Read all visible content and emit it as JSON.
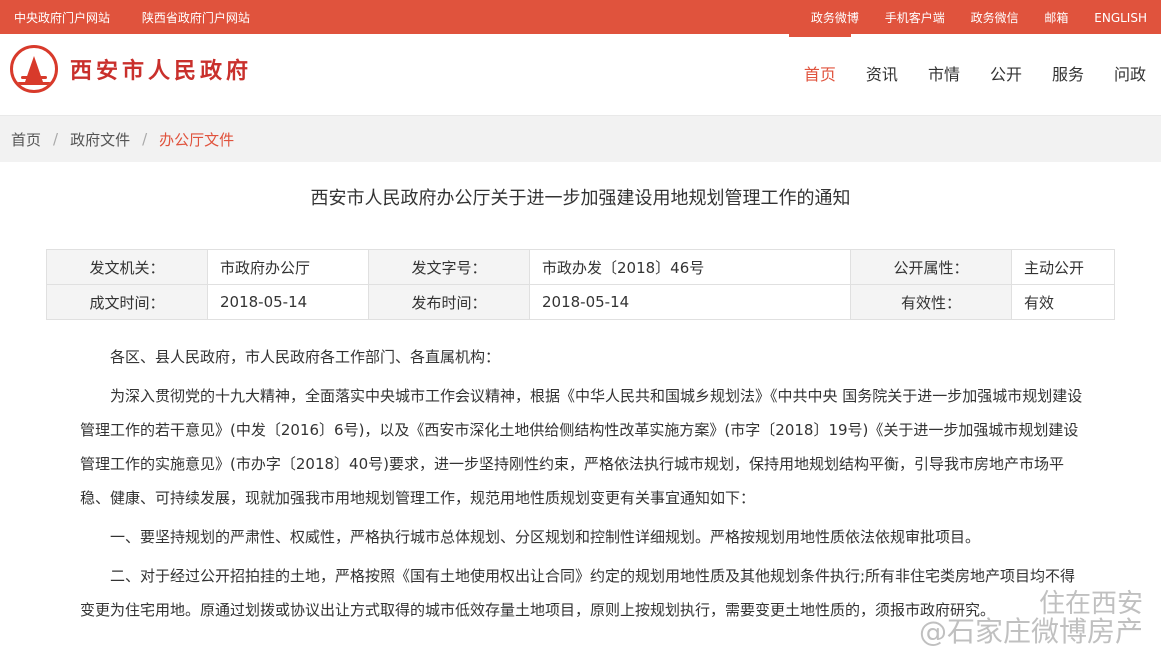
{
  "topbar": {
    "left": [
      "中央政府门户网站",
      "陕西省政府门户网站"
    ],
    "right": [
      "政务微博",
      "手机客户端",
      "政务微信",
      "邮箱",
      "ENGLISH"
    ]
  },
  "header": {
    "site_title": "西安市人民政府",
    "nav": [
      "首页",
      "资讯",
      "市情",
      "公开",
      "服务",
      "问政"
    ]
  },
  "breadcrumb": [
    "首页",
    "政府文件",
    "办公厅文件"
  ],
  "document": {
    "title": "西安市人民政府办公厅关于进一步加强建设用地规划管理工作的通知",
    "meta": {
      "issuer_label": "发文机关：",
      "issuer": "市政府办公厅",
      "docno_label": "发文字号：",
      "docno": "市政办发〔2018〕46号",
      "public_label": "公开属性：",
      "public": "主动公开",
      "created_label": "成文时间：",
      "created": "2018-05-14",
      "published_label": "发布时间：",
      "published": "2018-05-14",
      "validity_label": "有效性：",
      "validity": "有效"
    },
    "paragraphs": [
      "各区、县人民政府，市人民政府各工作部门、各直属机构：",
      "为深入贯彻党的十九大精神，全面落实中央城市工作会议精神，根据《中华人民共和国城乡规划法》《中共中央 国务院关于进一步加强城市规划建设管理工作的若干意见》(中发〔2016〕6号)，以及《西安市深化土地供给侧结构性改革实施方案》(市字〔2018〕19号)《关于进一步加强城市规划建设管理工作的实施意见》(市办字〔2018〕40号)要求，进一步坚持刚性约束，严格依法执行城市规划，保持用地规划结构平衡，引导我市房地产市场平稳、健康、可持续发展，现就加强我市用地规划管理工作，规范用地性质规划变更有关事宜通知如下：",
      "一、要坚持规划的严肃性、权威性，严格执行城市总体规划、分区规划和控制性详细规划。严格按规划用地性质依法依规审批项目。",
      "二、对于经过公开招拍挂的土地，严格按照《国有土地使用权出让合同》约定的规划用地性质及其他规划条件执行;所有非住宅类房地产项目均不得变更为住宅用地。原通过划拨或协议出让方式取得的城市低效存量土地项目，原则上按规划执行，需要变更土地性质的，须报市政府研究。"
    ]
  },
  "watermark": {
    "line1": "住在西安",
    "line2": "@石家庄微博房产"
  }
}
